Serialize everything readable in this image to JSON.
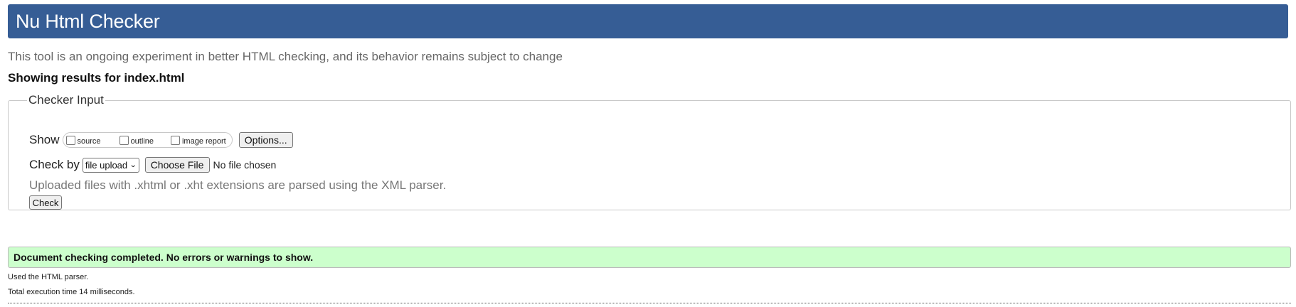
{
  "header": {
    "title": "Nu Html Checker"
  },
  "tagline": "This tool is an ongoing experiment in better HTML checking, and its behavior remains subject to change",
  "results_heading": "Showing results for index.html",
  "checker_input": {
    "legend": "Checker Input",
    "show_label": "Show",
    "show_options": [
      {
        "label": "source",
        "checked": false
      },
      {
        "label": "outline",
        "checked": false
      },
      {
        "label": "image report",
        "checked": false
      }
    ],
    "options_button": "Options...",
    "check_by_label": "Check by",
    "check_by_selected": "file upload",
    "choose_file_button": "Choose File",
    "no_file_text": "No file chosen",
    "note": "Uploaded files with .xhtml or .xht extensions are parsed using the XML parser.",
    "check_button": "Check"
  },
  "result": {
    "banner": "Document checking completed. No errors or warnings to show.",
    "parser_note": "Used the HTML parser.",
    "execution_time": "Total execution time 14 milliseconds."
  },
  "colors": {
    "header_bg": "#365d95",
    "success_bg": "#ccffcc"
  },
  "icons": {
    "select_arrow": "chevron-down-icon"
  }
}
